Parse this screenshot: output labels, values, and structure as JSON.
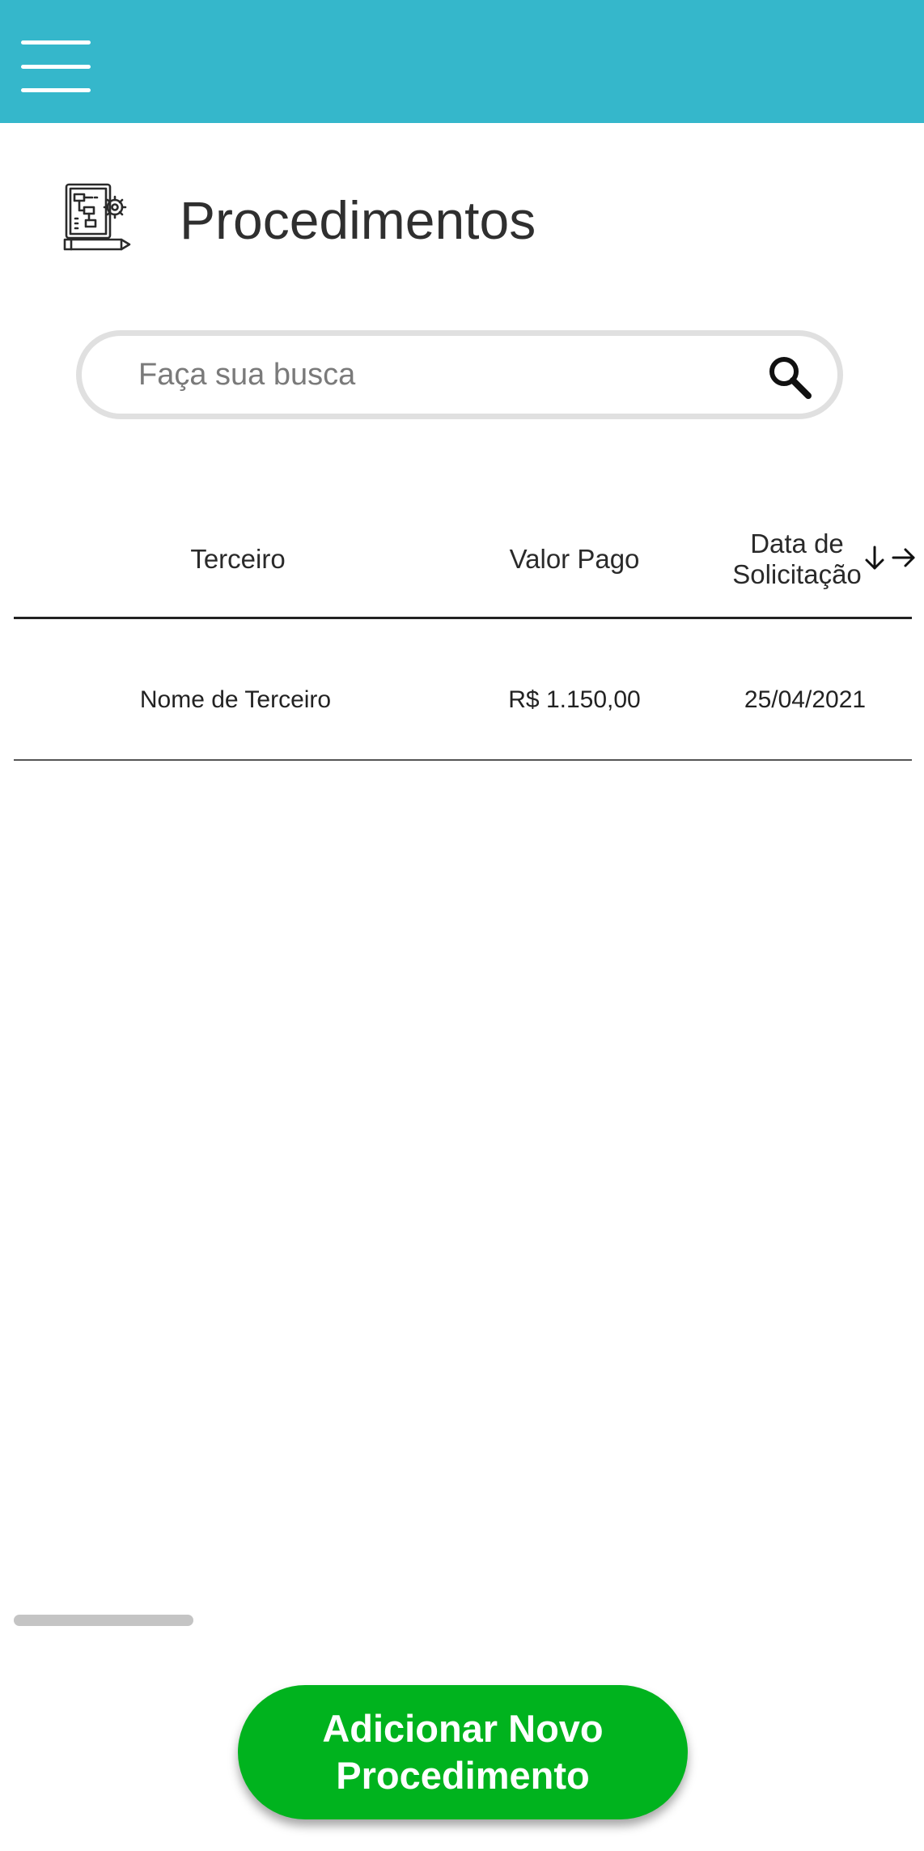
{
  "header": {
    "menu_icon": "hamburger-menu-icon",
    "color": "#35b7cb"
  },
  "page": {
    "title": "Procedimentos",
    "icon": "procedures-flowchart-icon"
  },
  "search": {
    "placeholder": "Faça sua busca",
    "value": "",
    "icon": "search-icon"
  },
  "table": {
    "columns": [
      "Terceiro",
      "Valor Pago",
      "Data de Solicitação"
    ],
    "date_header_line1": "Data de",
    "date_header_line2": "Solicitação",
    "sort_icon": "arrow-down-icon",
    "scroll_icon": "arrow-right-icon",
    "rows": [
      {
        "terceiro": "Nome de Terceiro",
        "valor_pago": "R$ 1.150,00",
        "data_solicitacao": "25/04/2021"
      }
    ]
  },
  "add_button": {
    "label": "Adicionar Novo Procedimento",
    "color": "#00b31e"
  }
}
